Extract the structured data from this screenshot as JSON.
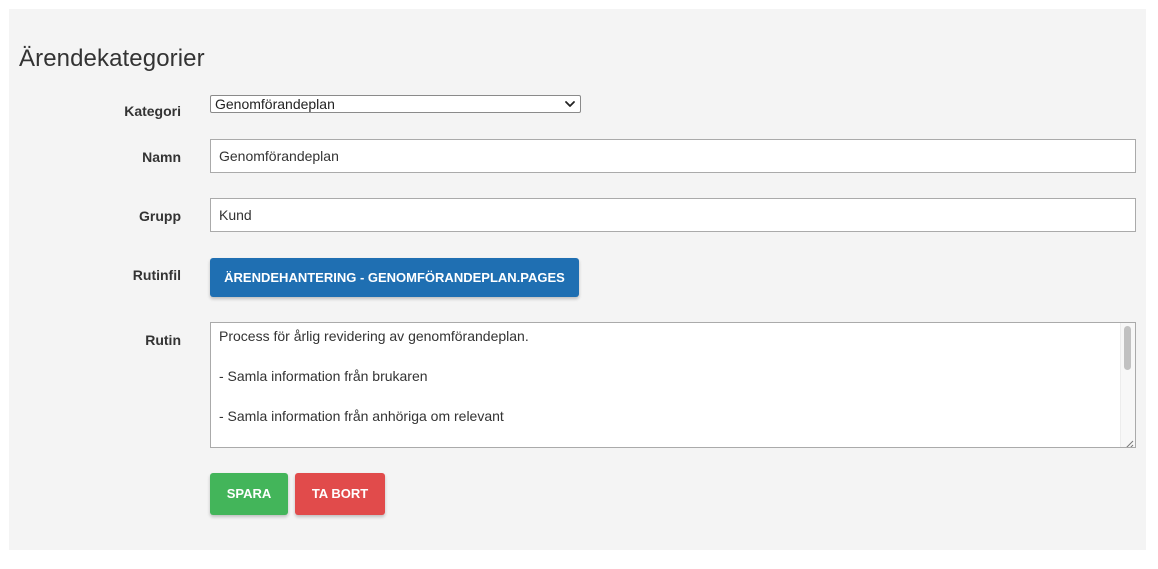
{
  "page": {
    "title": "Ärendekategorier"
  },
  "form": {
    "category": {
      "label": "Kategori",
      "selected": "Genomförandeplan"
    },
    "name": {
      "label": "Namn",
      "value": "Genomförandeplan"
    },
    "group": {
      "label": "Grupp",
      "value": "Kund"
    },
    "routine_file": {
      "label": "Rutinfil",
      "button_label": "ÄRENDEHANTERING - GENOMFÖRANDEPLAN.PAGES"
    },
    "routine": {
      "label": "Rutin",
      "lines": [
        "Process för årlig revidering av genomförandeplan.",
        "",
        "- Samla information från brukaren",
        "",
        "- Samla information från anhöriga om relevant"
      ]
    }
  },
  "actions": {
    "save_label": "SPARA",
    "delete_label": "TA BORT"
  },
  "colors": {
    "panel_bg": "#f4f4f4",
    "file_button": "#1f6fb2",
    "save_button": "#43b55a",
    "delete_button": "#e14b4b"
  },
  "icons": {
    "select_arrow": "chevron-down-icon",
    "textarea_resize": "resize-grip-icon"
  }
}
